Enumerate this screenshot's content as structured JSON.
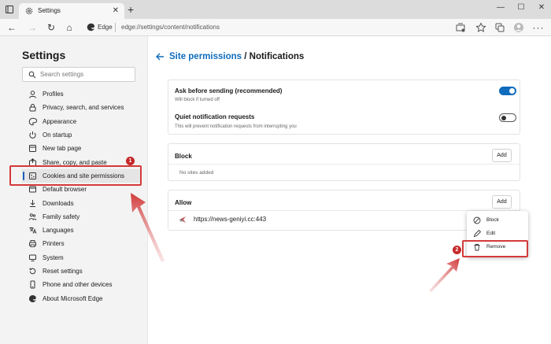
{
  "window": {
    "tab_title": "Settings",
    "tab_close": "✕",
    "new_tab": "+",
    "minimize": "—",
    "maximize": "☐",
    "close": "✕"
  },
  "toolbar": {
    "back": "←",
    "forward": "→",
    "refresh": "↻",
    "home": "⌂",
    "browser_label": "Edge",
    "url": "edge://settings/content/notifications"
  },
  "sidebar": {
    "title": "Settings",
    "search_placeholder": "Search settings",
    "items": [
      {
        "label": "Profiles",
        "icon": "profile-icon"
      },
      {
        "label": "Privacy, search, and services",
        "icon": "lock-icon"
      },
      {
        "label": "Appearance",
        "icon": "appearance-icon"
      },
      {
        "label": "On startup",
        "icon": "power-icon"
      },
      {
        "label": "New tab page",
        "icon": "new-tab-icon"
      },
      {
        "label": "Share, copy, and paste",
        "icon": "share-icon"
      },
      {
        "label": "Cookies and site permissions",
        "icon": "cookies-icon",
        "active": true
      },
      {
        "label": "Default browser",
        "icon": "browser-icon"
      },
      {
        "label": "Downloads",
        "icon": "download-icon"
      },
      {
        "label": "Family safety",
        "icon": "family-icon"
      },
      {
        "label": "Languages",
        "icon": "languages-icon"
      },
      {
        "label": "Printers",
        "icon": "printer-icon"
      },
      {
        "label": "System",
        "icon": "system-icon"
      },
      {
        "label": "Reset settings",
        "icon": "reset-icon"
      },
      {
        "label": "Phone and other devices",
        "icon": "phone-icon"
      },
      {
        "label": "About Microsoft Edge",
        "icon": "edge-icon"
      }
    ]
  },
  "main": {
    "breadcrumb_parent": "Site permissions",
    "breadcrumb_sep": " / ",
    "breadcrumb_current": "Notifications",
    "ask_before_sending": {
      "title": "Ask before sending (recommended)",
      "subtitle": "Will block if turned off",
      "enabled": true
    },
    "quiet_requests": {
      "title": "Quiet notification requests",
      "subtitle": "This will prevent notification requests from interrupting you",
      "enabled": false
    },
    "block": {
      "title": "Block",
      "add_label": "Add",
      "empty": "No sites added"
    },
    "allow": {
      "title": "Allow",
      "add_label": "Add",
      "sites": [
        {
          "url": "https://news-geniyi.cc:443"
        }
      ]
    },
    "context_menu": {
      "items": [
        {
          "label": "Block",
          "icon": "block-icon"
        },
        {
          "label": "Edit",
          "icon": "pencil-icon"
        },
        {
          "label": "Remove",
          "icon": "trash-icon"
        }
      ]
    }
  },
  "annotations": {
    "step1": "1",
    "step2": "2",
    "color": "#d33a3a"
  },
  "colors": {
    "accent": "#0f6cbd",
    "sidebar_bg": "#f3f3f3"
  }
}
